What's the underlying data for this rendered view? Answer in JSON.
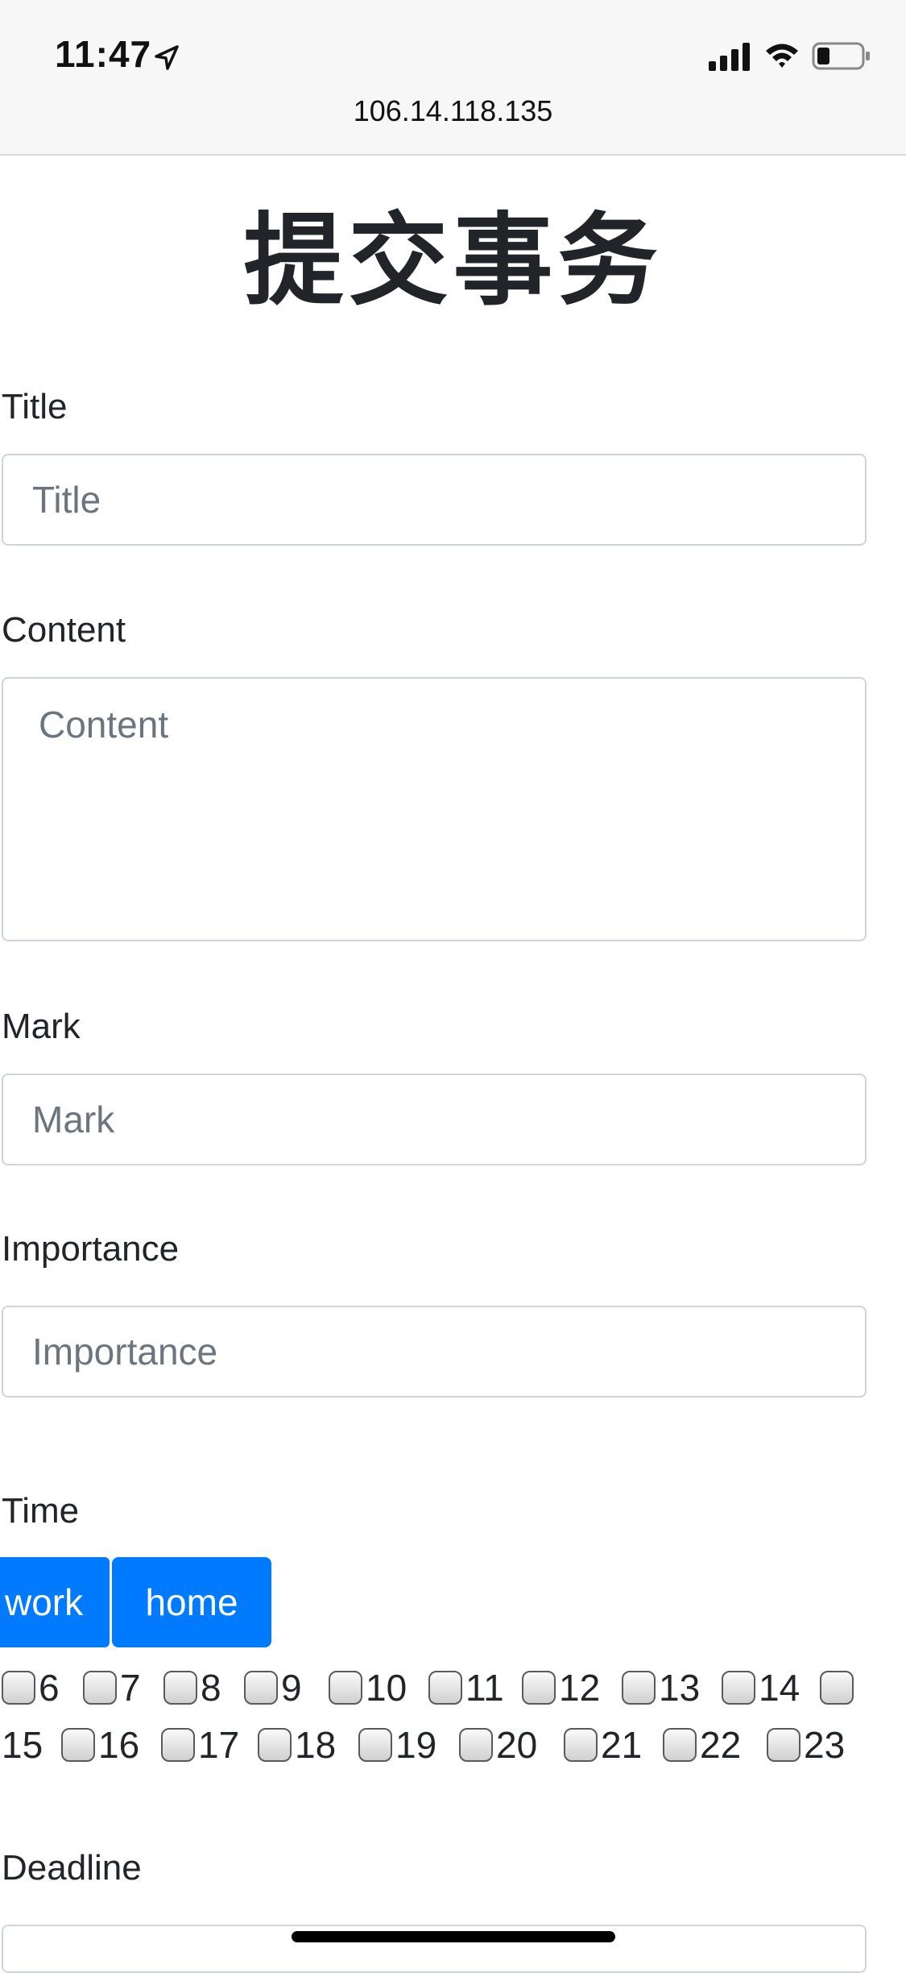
{
  "status_bar": {
    "time": "11:47"
  },
  "browser": {
    "url": "106.14.118.135"
  },
  "page": {
    "heading": "提交事务"
  },
  "form": {
    "title": {
      "label": "Title",
      "placeholder": "Title"
    },
    "content": {
      "label": "Content",
      "placeholder": "Content"
    },
    "mark": {
      "label": "Mark",
      "placeholder": "Mark"
    },
    "importance": {
      "label": "Importance",
      "placeholder": "Importance"
    },
    "time": {
      "label": "Time",
      "buttons": [
        "work",
        "home"
      ],
      "hours_row1": [
        "6",
        "7",
        "8",
        "9",
        "10",
        "11",
        "12",
        "13",
        "14"
      ],
      "hours_row2": [
        "15",
        "16",
        "17",
        "18",
        "19",
        "20",
        "21",
        "22",
        "23"
      ]
    },
    "deadline": {
      "label": "Deadline"
    }
  },
  "colors": {
    "primary": "#007bff",
    "text": "#212529",
    "placeholder": "#6c757d",
    "border": "#ced4da"
  }
}
